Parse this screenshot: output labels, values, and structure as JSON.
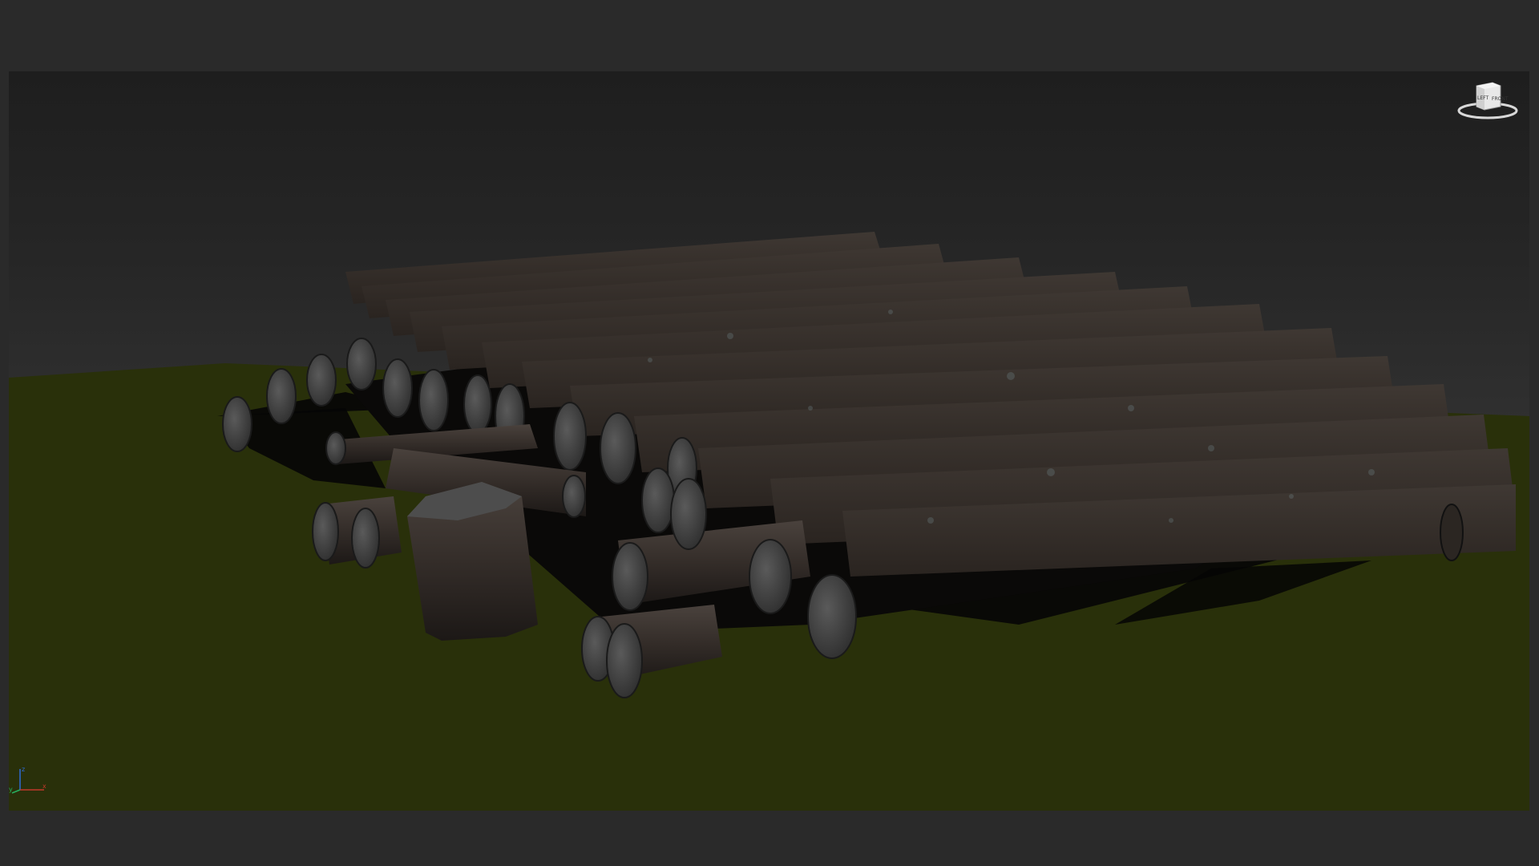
{
  "viewport": {
    "background_top": "#1e1e1e",
    "background_bottom": "#333333",
    "ground_color": "#29300a",
    "shadow_color": "#000000",
    "log_bark_color": "#3a3430",
    "log_end_color": "#4a4a4a"
  },
  "viewcube": {
    "face_front": "FRONT",
    "face_left": "LEFT"
  },
  "axis_tripod": {
    "x_label": "x",
    "y_label": "y",
    "z_label": "z",
    "x_color": "#c0392b",
    "y_color": "#27ae60",
    "z_color": "#2e6bd6"
  }
}
